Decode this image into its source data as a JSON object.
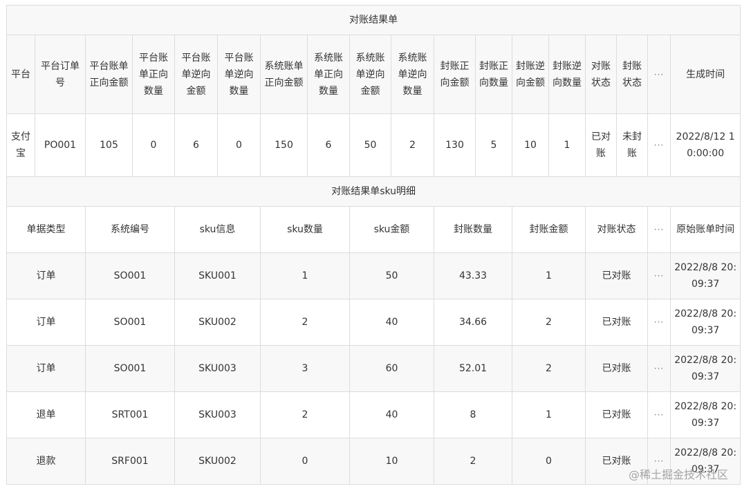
{
  "main_title": "对账结果单",
  "main_headers": [
    "平台",
    "平台订单号",
    "平台账单正向金额",
    "平台账单正向数量",
    "平台账单逆向金额",
    "平台账单逆向数量",
    "系统账单正向金额",
    "系统账单正向数量",
    "系统账单逆向金额",
    "系统账单逆向数量",
    "封账正向金额",
    "封账正向数量",
    "封账逆向金额",
    "封账逆向数量",
    "对账状态",
    "封账状态",
    "···",
    "生成时间"
  ],
  "main_row": [
    "支付宝",
    "PO001",
    "105",
    "0",
    "6",
    "0",
    "150",
    "6",
    "50",
    "2",
    "130",
    "5",
    "10",
    "1",
    "已对账",
    "未封账",
    "···",
    "2022/8/12 10:00:00"
  ],
  "detail_title": "对账结果单sku明细",
  "detail_headers": [
    "单据类型",
    "系统编号",
    "sku信息",
    "sku数量",
    "sku金额",
    "封账数量",
    "封账金额",
    "对账状态",
    "···",
    "原始账单时间"
  ],
  "detail_rows": [
    [
      "订单",
      "SO001",
      "SKU001",
      "1",
      "50",
      "43.33",
      "1",
      "已对账",
      "···",
      "2022/8/8 20:09:37"
    ],
    [
      "订单",
      "SO001",
      "SKU002",
      "2",
      "40",
      "34.66",
      "2",
      "已对账",
      "···",
      "2022/8/8 20:09:37"
    ],
    [
      "订单",
      "SO001",
      "SKU003",
      "3",
      "60",
      "52.01",
      "2",
      "已对账",
      "···",
      "2022/8/8 20:09:37"
    ],
    [
      "退单",
      "SRT001",
      "SKU003",
      "2",
      "40",
      "8",
      "1",
      "已对账",
      "···",
      "2022/8/8 20:09:37"
    ],
    [
      "退款",
      "SRF001",
      "SKU002",
      "0",
      "10",
      "2",
      "0",
      "已对账",
      "···",
      "2022/8/8 20:09:37"
    ]
  ],
  "watermark": "@稀土掘金技术社区"
}
